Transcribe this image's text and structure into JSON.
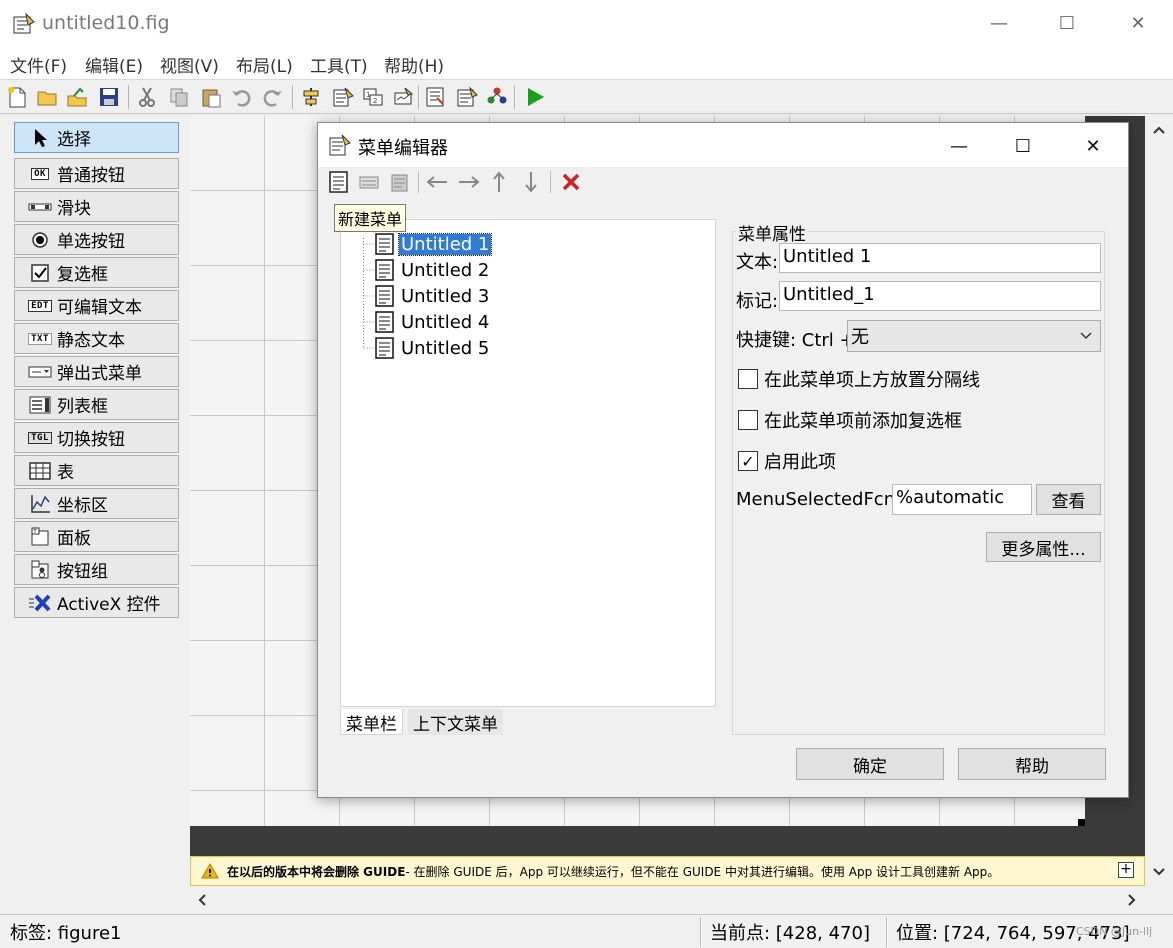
{
  "window": {
    "title": "untitled10.fig",
    "minimize": "—",
    "maximize": "☐",
    "close": "✕"
  },
  "menubar": [
    "文件(F)",
    "编辑(E)",
    "视图(V)",
    "布局(L)",
    "工具(T)",
    "帮助(H)"
  ],
  "palette": [
    {
      "label": "选择",
      "icon": "pointer-icon",
      "glyph": "➤"
    },
    {
      "label": "普通按钮",
      "icon": "push-button-icon",
      "glyph": "OK"
    },
    {
      "label": "滑块",
      "icon": "slider-icon",
      "glyph": ""
    },
    {
      "label": "单选按钮",
      "icon": "radio-button-icon",
      "glyph": ""
    },
    {
      "label": "复选框",
      "icon": "checkbox-icon",
      "glyph": "✓"
    },
    {
      "label": "可编辑文本",
      "icon": "edit-text-icon",
      "glyph": "EDT"
    },
    {
      "label": "静态文本",
      "icon": "static-text-icon",
      "glyph": "TXT"
    },
    {
      "label": "弹出式菜单",
      "icon": "popup-menu-icon",
      "glyph": ""
    },
    {
      "label": "列表框",
      "icon": "listbox-icon",
      "glyph": ""
    },
    {
      "label": "切换按钮",
      "icon": "toggle-button-icon",
      "glyph": "TGL"
    },
    {
      "label": "表",
      "icon": "table-icon",
      "glyph": ""
    },
    {
      "label": "坐标区",
      "icon": "axes-icon",
      "glyph": ""
    },
    {
      "label": "面板",
      "icon": "panel-icon",
      "glyph": ""
    },
    {
      "label": "按钮组",
      "icon": "button-group-icon",
      "glyph": ""
    },
    {
      "label": "ActiveX 控件",
      "icon": "activex-icon",
      "glyph": "X"
    }
  ],
  "warning": {
    "bold": "在以后的版本中将会删除 GUIDE",
    "text": " - 在删除 GUIDE 后，App 可以继续运行，但不能在 GUIDE 中对其进行编辑。使用 App 设计工具创建新 App。",
    "expand": "+"
  },
  "status": {
    "tag": "标签: figure1",
    "current_point": "当前点:  [428, 470]",
    "position": "位置: [724, 764, 597, 473]",
    "watermark": "CSDN @Jun-llj"
  },
  "dialog": {
    "title": "菜单编辑器",
    "tooltip": "新建菜单",
    "tree_items": [
      "Untitled 1",
      "Untitled 2",
      "Untitled 3",
      "Untitled 4",
      "Untitled 5"
    ],
    "tabs": [
      "菜单栏",
      "上下文菜单"
    ],
    "props_title": "菜单属性",
    "text_label": "文本:",
    "text_value": "Untitled 1",
    "tag_label": "标记:",
    "tag_value": "Untitled_1",
    "shortcut_label": "快捷键: Ctrl +",
    "shortcut_value": "无",
    "separator_label": "在此菜单项上方放置分隔线",
    "check_label": "在此菜单项前添加复选框",
    "enable_label": "启用此项",
    "enable_mark": "✓",
    "callback_label": "MenuSelectedFcn:",
    "callback_value": "%automatic",
    "view_button": "查看",
    "more_button": "更多属性...",
    "ok_button": "确定",
    "help_button": "帮助"
  }
}
